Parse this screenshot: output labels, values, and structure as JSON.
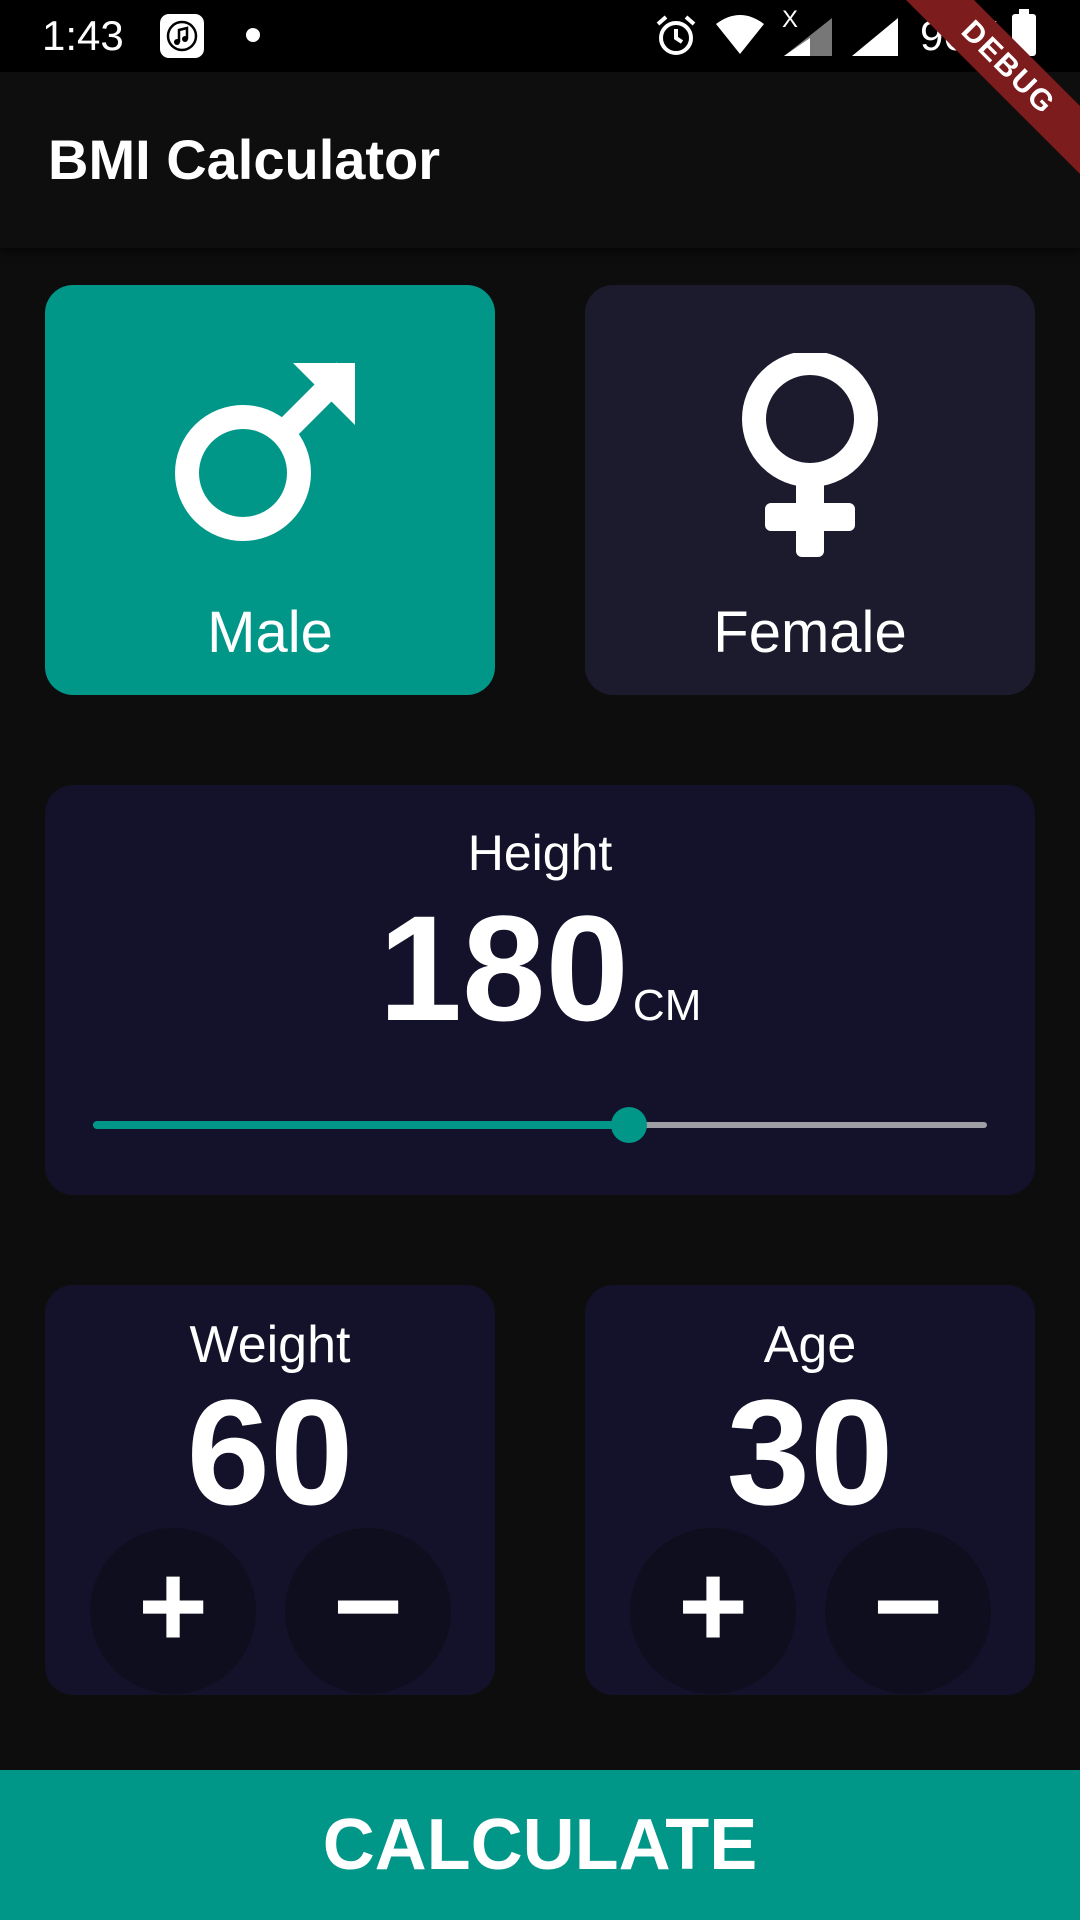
{
  "status_bar": {
    "time": "1:43",
    "battery": "96%",
    "x_mark": "X"
  },
  "debug_banner": "DEBUG",
  "app_bar": {
    "title": "BMI Calculator"
  },
  "gender": {
    "male_label": "Male",
    "female_label": "Female",
    "selected": "Male",
    "selected_color": "#009688",
    "inactive_color": "#1c1b2e"
  },
  "height": {
    "label": "Height",
    "value": "180",
    "unit": "CM",
    "slider_fraction": 0.6
  },
  "weight": {
    "label": "Weight",
    "value": "60",
    "plus": "+",
    "minus": "−"
  },
  "age": {
    "label": "Age",
    "value": "30",
    "plus": "+",
    "minus": "−"
  },
  "calculate_label": "CALCULATE",
  "colors": {
    "accent": "#009688",
    "background": "#0d0d0d",
    "card": "#13122a"
  },
  "icons": [
    "music-icon",
    "alarm-icon",
    "wifi-icon",
    "signal-icon",
    "battery-icon",
    "male-icon",
    "female-icon"
  ]
}
